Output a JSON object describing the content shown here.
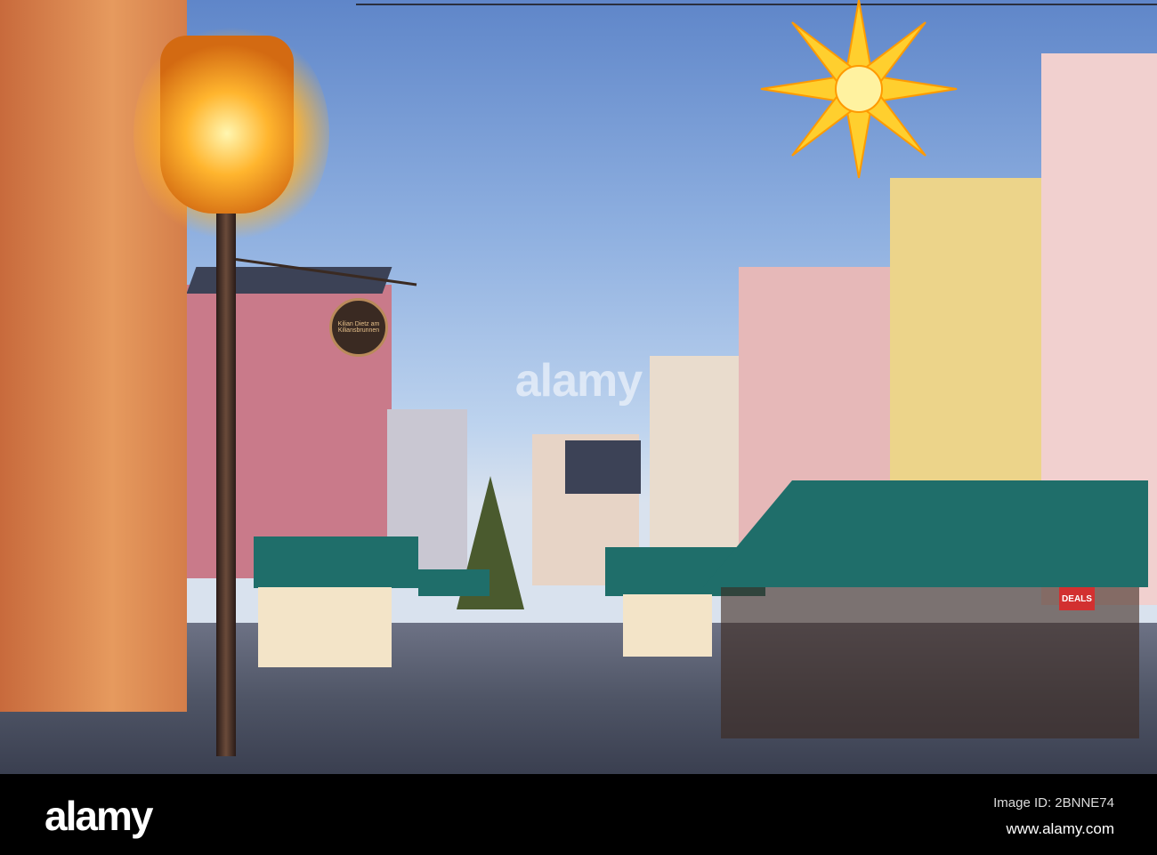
{
  "photo": {
    "shop_sign_text": "Kilian Dietz am Kiliansbrunnen",
    "shop_window_text": "DEALS",
    "watermark": "alamy"
  },
  "footer": {
    "logo": "alamy",
    "image_id": "Image ID: 2BNNE74",
    "url": "www.alamy.com"
  }
}
